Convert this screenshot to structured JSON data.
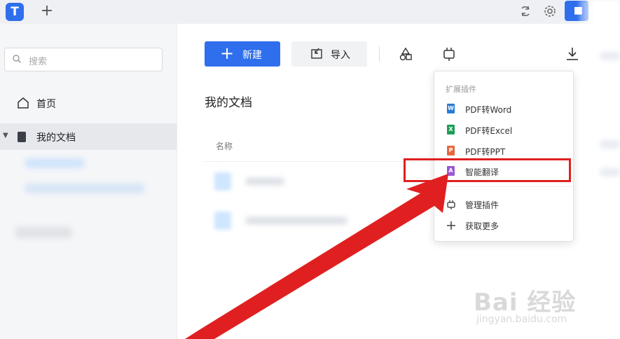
{
  "titlebar": {
    "logo_text": "T",
    "new_tab_icon": "plus-icon",
    "sync_icon": "sync-icon",
    "settings_icon": "gear-icon",
    "accent": "#2f6fed"
  },
  "sidebar": {
    "search_placeholder": "搜索",
    "home_label": "首页",
    "docs_label": "我的文档"
  },
  "toolbar": {
    "new_label": "新建",
    "import_label": "导入",
    "shapes_icon": "shapes-icon",
    "plugin_icon": "plug-icon",
    "download_icon": "download-icon"
  },
  "main": {
    "title": "我的文档",
    "column_name": "名称"
  },
  "dropdown": {
    "header": "扩展插件",
    "items": [
      {
        "label": "PDF转Word",
        "icon": "word-icon",
        "color": "#2b7cd3",
        "glyph": "W"
      },
      {
        "label": "PDF转Excel",
        "icon": "excel-icon",
        "color": "#1e9e58",
        "glyph": "X"
      },
      {
        "label": "PDF转PPT",
        "icon": "ppt-icon",
        "color": "#e8663d",
        "glyph": "P"
      },
      {
        "label": "智能翻译",
        "icon": "translate-icon",
        "color": "#9b59d0",
        "glyph": "A"
      }
    ],
    "manage_label": "管理插件",
    "more_label": "获取更多"
  },
  "annotation": {
    "highlight_color": "#e02020"
  },
  "watermark": {
    "brand": "Bai 经验",
    "url": "jingyan.baidu.com"
  }
}
